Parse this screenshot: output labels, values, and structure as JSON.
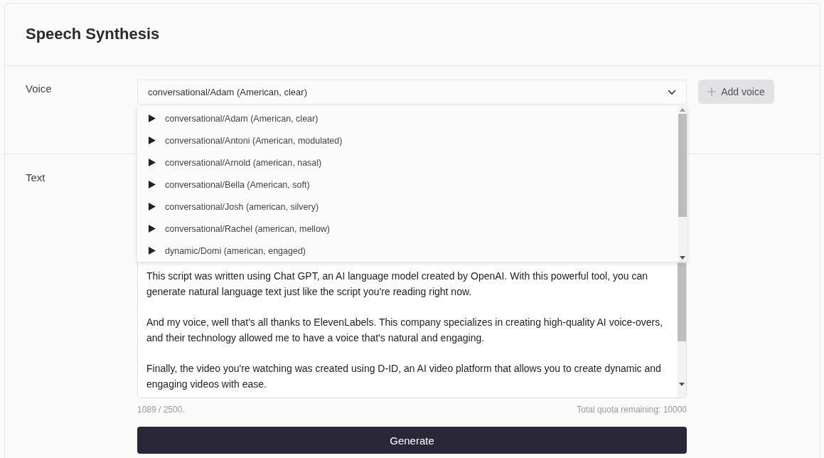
{
  "title": "Speech Synthesis",
  "voice": {
    "label": "Voice",
    "value": "conversational/Adam (American, clear)",
    "open": true,
    "options": [
      "conversational/Adam (American, clear)",
      "conversational/Antoni (American, modulated)",
      "conversational/Arnold (american, nasal)",
      "conversational/Bella (American, soft)",
      "conversational/Josh (american, silvery)",
      "conversational/Rachel (american, mellow)",
      "dynamic/Domi (american, engaged)"
    ],
    "add_button": "Add voice"
  },
  "text": {
    "label": "Text",
    "paragraphs": [
      "This script was written using Chat GPT, an AI language model created by OpenAI. With this powerful tool, you can generate natural language text just like the script you're reading right now.",
      "And my voice, well that's all thanks to ElevenLabels. This company specializes in creating high-quality AI voice-overs, and their technology allowed me to have a voice that's natural and engaging.",
      "Finally, the video you're watching was created using D-ID, an AI video platform that allows you to create dynamic and engaging videos with ease."
    ],
    "count": "1089 / 2500.",
    "quota": "Total quota remaining: 10000"
  },
  "generate_button": "Generate"
}
